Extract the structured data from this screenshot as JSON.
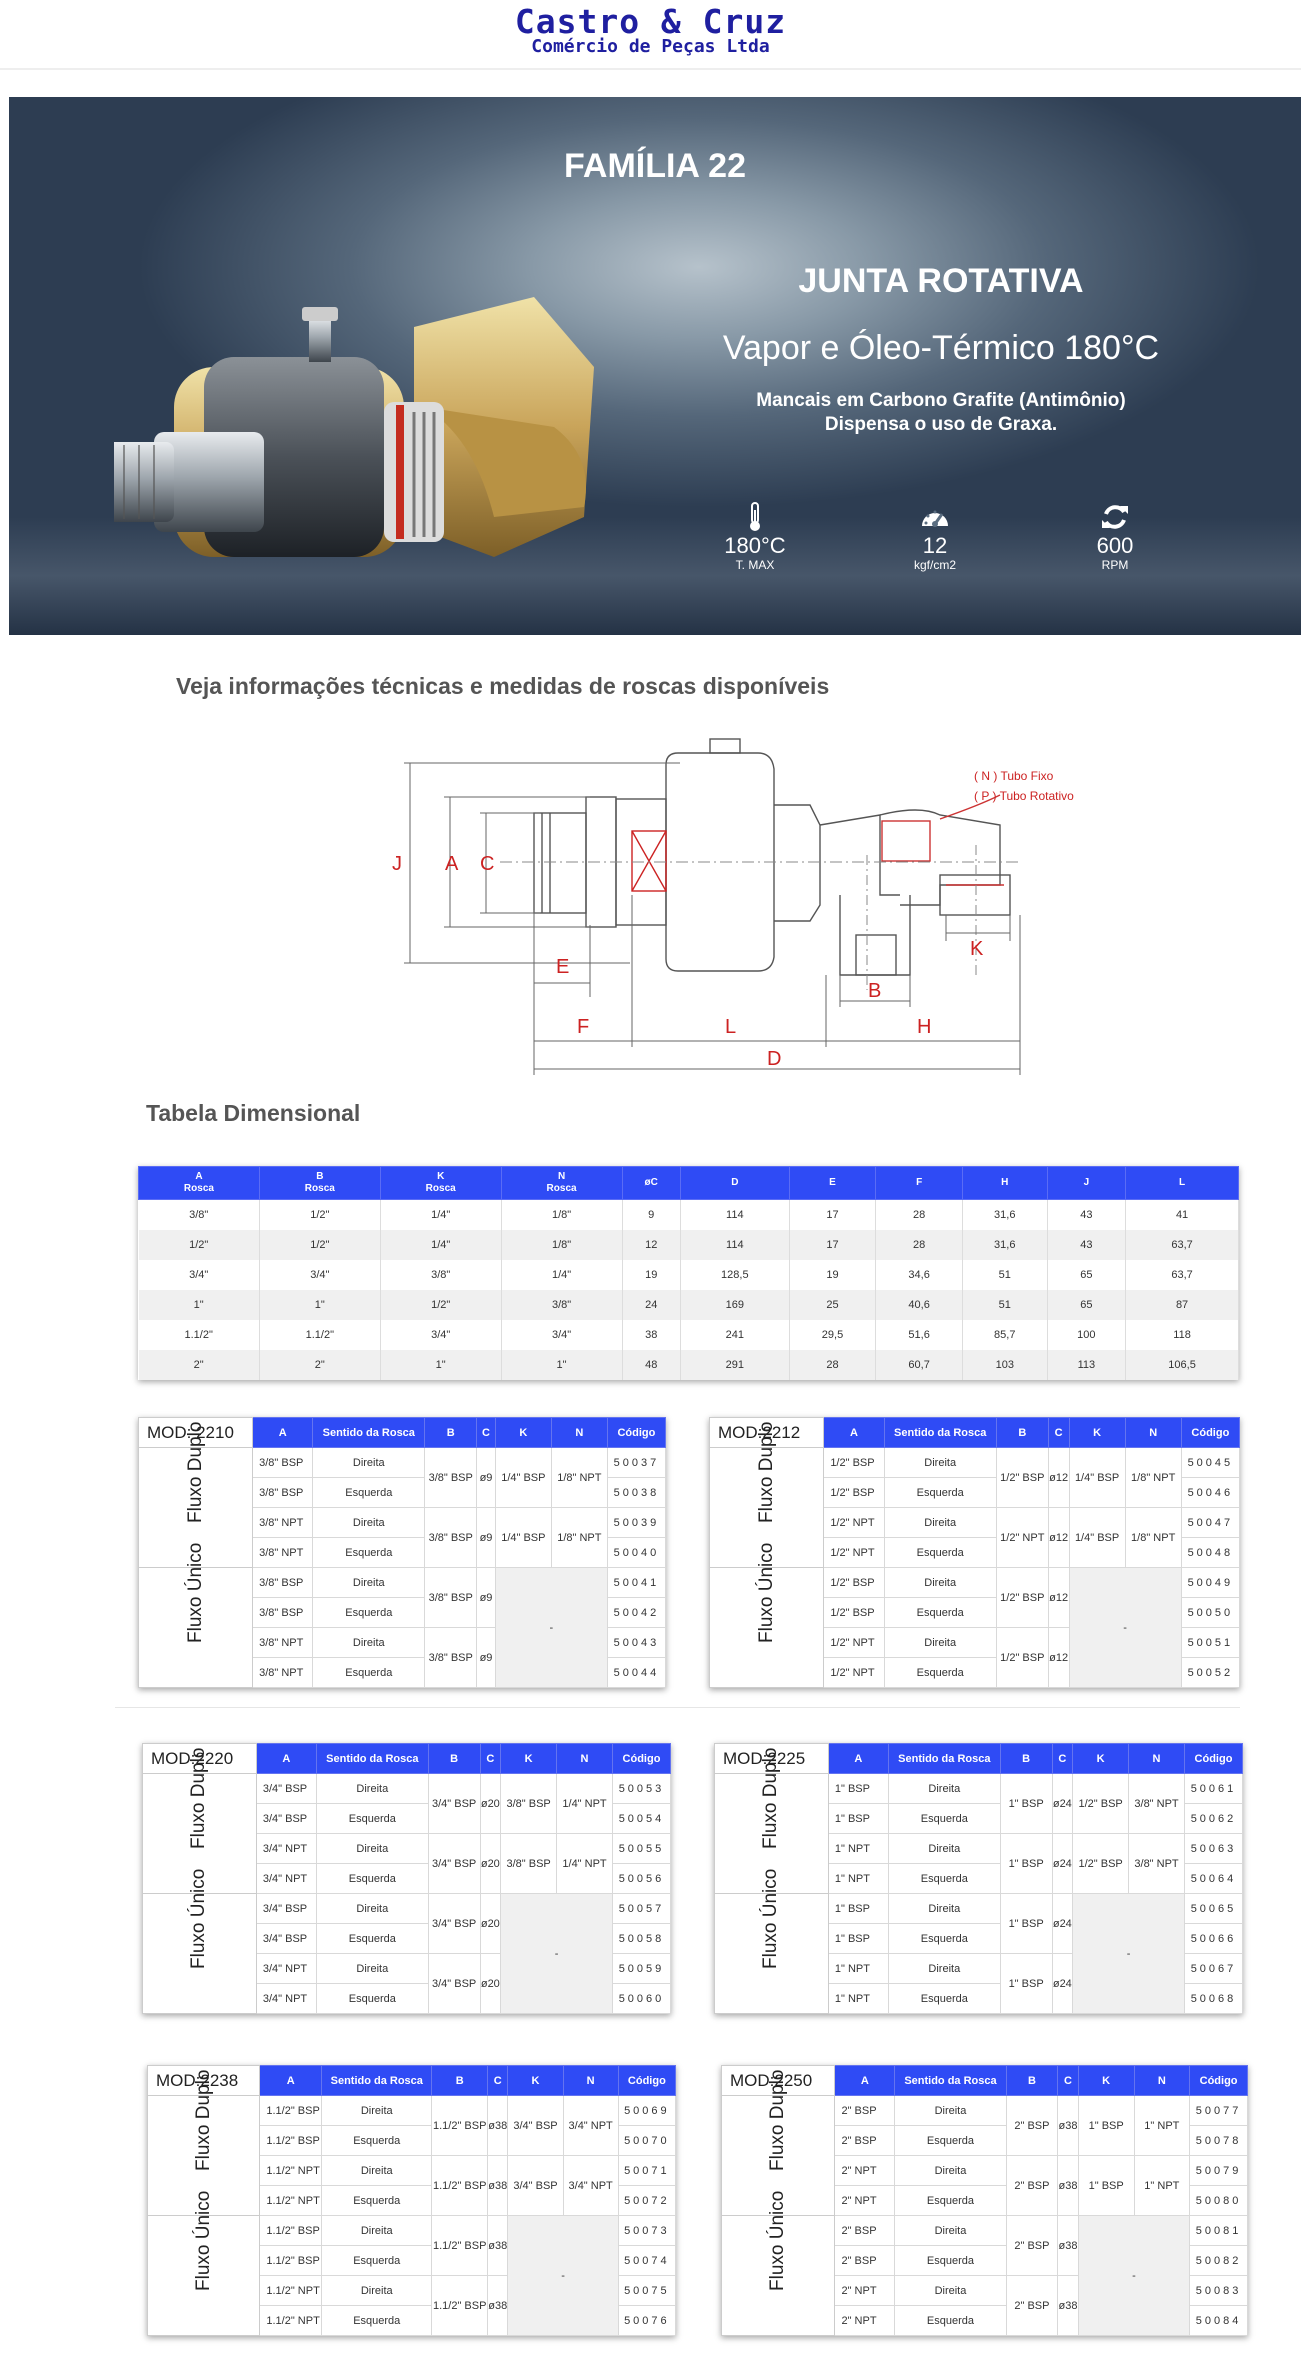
{
  "header": {
    "brand": "Castro & Cruz",
    "tagline": "Comércio de Peças Ltda"
  },
  "hero": {
    "family": "FAMÍLIA 22",
    "product": "JUNTA ROTATIVA",
    "subtitle": "Vapor e Óleo-Térmico 180°C",
    "features": [
      "Mancais em Carbono Grafite (Antimônio)",
      "Dispensa o uso de Graxa."
    ],
    "specs": [
      {
        "icon": "thermometer-icon",
        "value": "180°C",
        "unit": "T. MAX"
      },
      {
        "icon": "gauge-icon",
        "value": "12",
        "unit": "kgf/cm2"
      },
      {
        "icon": "refresh-icon",
        "value": "600",
        "unit": "RPM"
      }
    ]
  },
  "info_title": "Veja informações técnicas e medidas de roscas disponíveis",
  "diagram": {
    "legend_n": "( N )  Tubo Fixo",
    "legend_p": "( P ) Tubo Rotativo",
    "labels": {
      "J": "J",
      "A": "A",
      "C": "C",
      "E": "E",
      "F": "F",
      "L": "L",
      "B": "B",
      "H": "H",
      "D": "D",
      "K": "K"
    }
  },
  "dim_title": "Tabela Dimensional",
  "dim_table": {
    "headers": [
      [
        "A",
        "Rosca"
      ],
      [
        "B",
        "Rosca"
      ],
      [
        "K",
        "Rosca"
      ],
      [
        "N",
        "Rosca"
      ],
      [
        "øC",
        ""
      ],
      [
        "D",
        ""
      ],
      [
        "E",
        ""
      ],
      [
        "F",
        ""
      ],
      [
        "H",
        ""
      ],
      [
        "J",
        ""
      ],
      [
        "L",
        ""
      ]
    ],
    "rows": [
      [
        "3/8\"",
        "1/2\"",
        "1/4\"",
        "1/8\"",
        "9",
        "114",
        "17",
        "28",
        "31,6",
        "43",
        "41"
      ],
      [
        "1/2\"",
        "1/2\"",
        "1/4\"",
        "1/8\"",
        "12",
        "114",
        "17",
        "28",
        "31,6",
        "43",
        "63,7"
      ],
      [
        "3/4\"",
        "3/4\"",
        "3/8\"",
        "1/4\"",
        "19",
        "128,5",
        "19",
        "34,6",
        "51",
        "65",
        "63,7"
      ],
      [
        "1\"",
        "1\"",
        "1/2\"",
        "3/8\"",
        "24",
        "169",
        "25",
        "40,6",
        "51",
        "65",
        "87"
      ],
      [
        "1.1/2\"",
        "1.1/2\"",
        "3/4\"",
        "3/4\"",
        "38",
        "241",
        "29,5",
        "51,6",
        "85,7",
        "100",
        "118"
      ],
      [
        "2\"",
        "2\"",
        "1\"",
        "1\"",
        "48",
        "291",
        "28",
        "60,7",
        "103",
        "113",
        "106,5"
      ]
    ]
  },
  "model_headers": [
    "A",
    "Sentido da Rosca",
    "B",
    "C",
    "K",
    "N",
    "Código"
  ],
  "group_duplo": "Fluxo Duplo",
  "group_unico": "Fluxo Único",
  "dash": "-",
  "models": [
    {
      "name": "MOD: 2210",
      "a": [
        "3/8\" BSP",
        "3/8\" BSP",
        "3/8\" NPT",
        "3/8\" NPT",
        "3/8\" BSP",
        "3/8\" BSP",
        "3/8\" NPT",
        "3/8\" NPT"
      ],
      "s": [
        "Direita",
        "Esquerda",
        "Direita",
        "Esquerda",
        "Direita",
        "Esquerda",
        "Direita",
        "Esquerda"
      ],
      "b": [
        "3/8\" BSP",
        "3/8\" BSP",
        "3/8\" BSP",
        "3/8\" BSP"
      ],
      "c": [
        "ø9",
        "ø9",
        "ø9",
        "ø9"
      ],
      "k": [
        "1/4\" BSP",
        "1/4\" BSP"
      ],
      "n": [
        "1/8\" NPT",
        "1/8\" NPT"
      ],
      "codes": [
        "50037",
        "50038",
        "50039",
        "50040",
        "50041",
        "50042",
        "50043",
        "50044"
      ]
    },
    {
      "name": "MOD:2212",
      "a": [
        "1/2\" BSP",
        "1/2\" BSP",
        "1/2\" NPT",
        "1/2\" NPT",
        "1/2\" BSP",
        "1/2\" BSP",
        "1/2\" NPT",
        "1/2\" NPT"
      ],
      "s": [
        "Direita",
        "Esquerda",
        "Direita",
        "Esquerda",
        "Direita",
        "Esquerda",
        "Direita",
        "Esquerda"
      ],
      "b": [
        "1/2\" BSP",
        "1/2\" NPT",
        "1/2\" BSP",
        "1/2\" BSP"
      ],
      "c": [
        "ø12",
        "ø12",
        "ø12",
        "ø12"
      ],
      "k": [
        "1/4\" BSP",
        "1/4\" BSP"
      ],
      "n": [
        "1/8\" NPT",
        "1/8\" NPT"
      ],
      "codes": [
        "50045",
        "50046",
        "50047",
        "50048",
        "50049",
        "50050",
        "50051",
        "50052"
      ]
    },
    {
      "name": "MOD:2220",
      "a": [
        "3/4\" BSP",
        "3/4\" BSP",
        "3/4\" NPT",
        "3/4\" NPT",
        "3/4\" BSP",
        "3/4\" BSP",
        "3/4\" NPT",
        "3/4\" NPT"
      ],
      "s": [
        "Direita",
        "Esquerda",
        "Direita",
        "Esquerda",
        "Direita",
        "Esquerda",
        "Direita",
        "Esquerda"
      ],
      "b": [
        "3/4\" BSP",
        "3/4\" BSP",
        "3/4\" BSP",
        "3/4\" BSP"
      ],
      "c": [
        "ø20",
        "ø20",
        "ø20",
        "ø20"
      ],
      "k": [
        "3/8\" BSP",
        "3/8\" BSP"
      ],
      "n": [
        "1/4\" NPT",
        "1/4\" NPT"
      ],
      "codes": [
        "50053",
        "50054",
        "50055",
        "50056",
        "50057",
        "50058",
        "50059",
        "50060"
      ]
    },
    {
      "name": "MOD:2225",
      "a": [
        "1\" BSP",
        "1\" BSP",
        "1\" NPT",
        "1\" NPT",
        "1\" BSP",
        "1\" BSP",
        "1\" NPT",
        "1\" NPT"
      ],
      "s": [
        "Direita",
        "Esquerda",
        "Direita",
        "Esquerda",
        "Direita",
        "Esquerda",
        "Direita",
        "Esquerda"
      ],
      "b": [
        "1\" BSP",
        "1\" BSP",
        "1\" BSP",
        "1\" BSP"
      ],
      "c": [
        "ø24",
        "ø24",
        "ø24",
        "ø24"
      ],
      "k": [
        "1/2\" BSP",
        "1/2\" BSP"
      ],
      "n": [
        "3/8\" NPT",
        "3/8\" NPT"
      ],
      "codes": [
        "50061",
        "50062",
        "50063",
        "50064",
        "50065",
        "50066",
        "50067",
        "50068"
      ]
    },
    {
      "name": "MOD:2238",
      "a": [
        "1.1/2\" BSP",
        "1.1/2\" BSP",
        "1.1/2\" NPT",
        "1.1/2\" NPT",
        "1.1/2\" BSP",
        "1.1/2\" BSP",
        "1.1/2\" NPT",
        "1.1/2\" NPT"
      ],
      "s": [
        "Direita",
        "Esquerda",
        "Direita",
        "Esquerda",
        "Direita",
        "Esquerda",
        "Direita",
        "Esquerda"
      ],
      "b": [
        "1.1/2\" BSP",
        "1.1/2\" BSP",
        "1.1/2\" BSP",
        "1.1/2\" BSP"
      ],
      "c": [
        "ø38",
        "ø38",
        "ø38",
        "ø38"
      ],
      "k": [
        "3/4\" BSP",
        "3/4\" BSP"
      ],
      "n": [
        "3/4\" NPT",
        "3/4\" NPT"
      ],
      "codes": [
        "50069",
        "50070",
        "50071",
        "50072",
        "50073",
        "50074",
        "50075",
        "50076"
      ]
    },
    {
      "name": "MOD:2250",
      "a": [
        "2\" BSP",
        "2\" BSP",
        "2\" NPT",
        "2\" NPT",
        "2\" BSP",
        "2\" BSP",
        "2\" NPT",
        "2\" NPT"
      ],
      "s": [
        "Direita",
        "Esquerda",
        "Direita",
        "Esquerda",
        "Direita",
        "Esquerda",
        "Direita",
        "Esquerda"
      ],
      "b": [
        "2\" BSP",
        "2\" BSP",
        "2\" BSP",
        "2\" BSP"
      ],
      "c": [
        "ø38",
        "ø38",
        "ø38",
        "ø38"
      ],
      "k": [
        "1\" BSP",
        "1\" BSP"
      ],
      "n": [
        "1\" NPT",
        "1\" NPT"
      ],
      "codes": [
        "50077",
        "50078",
        "50079",
        "50080",
        "50081",
        "50082",
        "50083",
        "50084"
      ]
    }
  ]
}
